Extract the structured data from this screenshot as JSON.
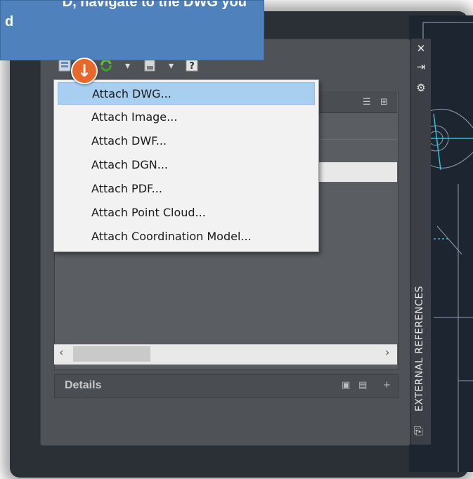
{
  "callout": {
    "line1": "D, navigate to the DWG you",
    "line2": "d"
  },
  "step_marker": {
    "glyph": "↓",
    "color": "#e8672a"
  },
  "toolbar": {
    "attach_icon": "attach-icon",
    "refresh_icon": "refresh-icon",
    "change_path_icon": "path-icon",
    "help_icon": "help-icon"
  },
  "menu": {
    "items": [
      {
        "label": "Attach DWG...",
        "highlighted": true
      },
      {
        "label": "Attach Image...",
        "highlighted": false
      },
      {
        "label": "Attach DWF...",
        "highlighted": false
      },
      {
        "label": "Attach DGN...",
        "highlighted": false
      },
      {
        "label": "Attach PDF...",
        "highlighted": false
      },
      {
        "label": "Attach Point Cloud...",
        "highlighted": false
      },
      {
        "label": "Attach Coordination Model...",
        "highlighted": false
      }
    ]
  },
  "palette": {
    "title": "EXTERNAL REFERENCES",
    "details_label": "Details",
    "strip_icons": [
      "close-icon",
      "autohide-icon",
      "properties-icon"
    ]
  },
  "colors": {
    "highlight": "#a9cff0",
    "callout_bg": "#4f81bd",
    "palette_bg": "#4f5358"
  }
}
